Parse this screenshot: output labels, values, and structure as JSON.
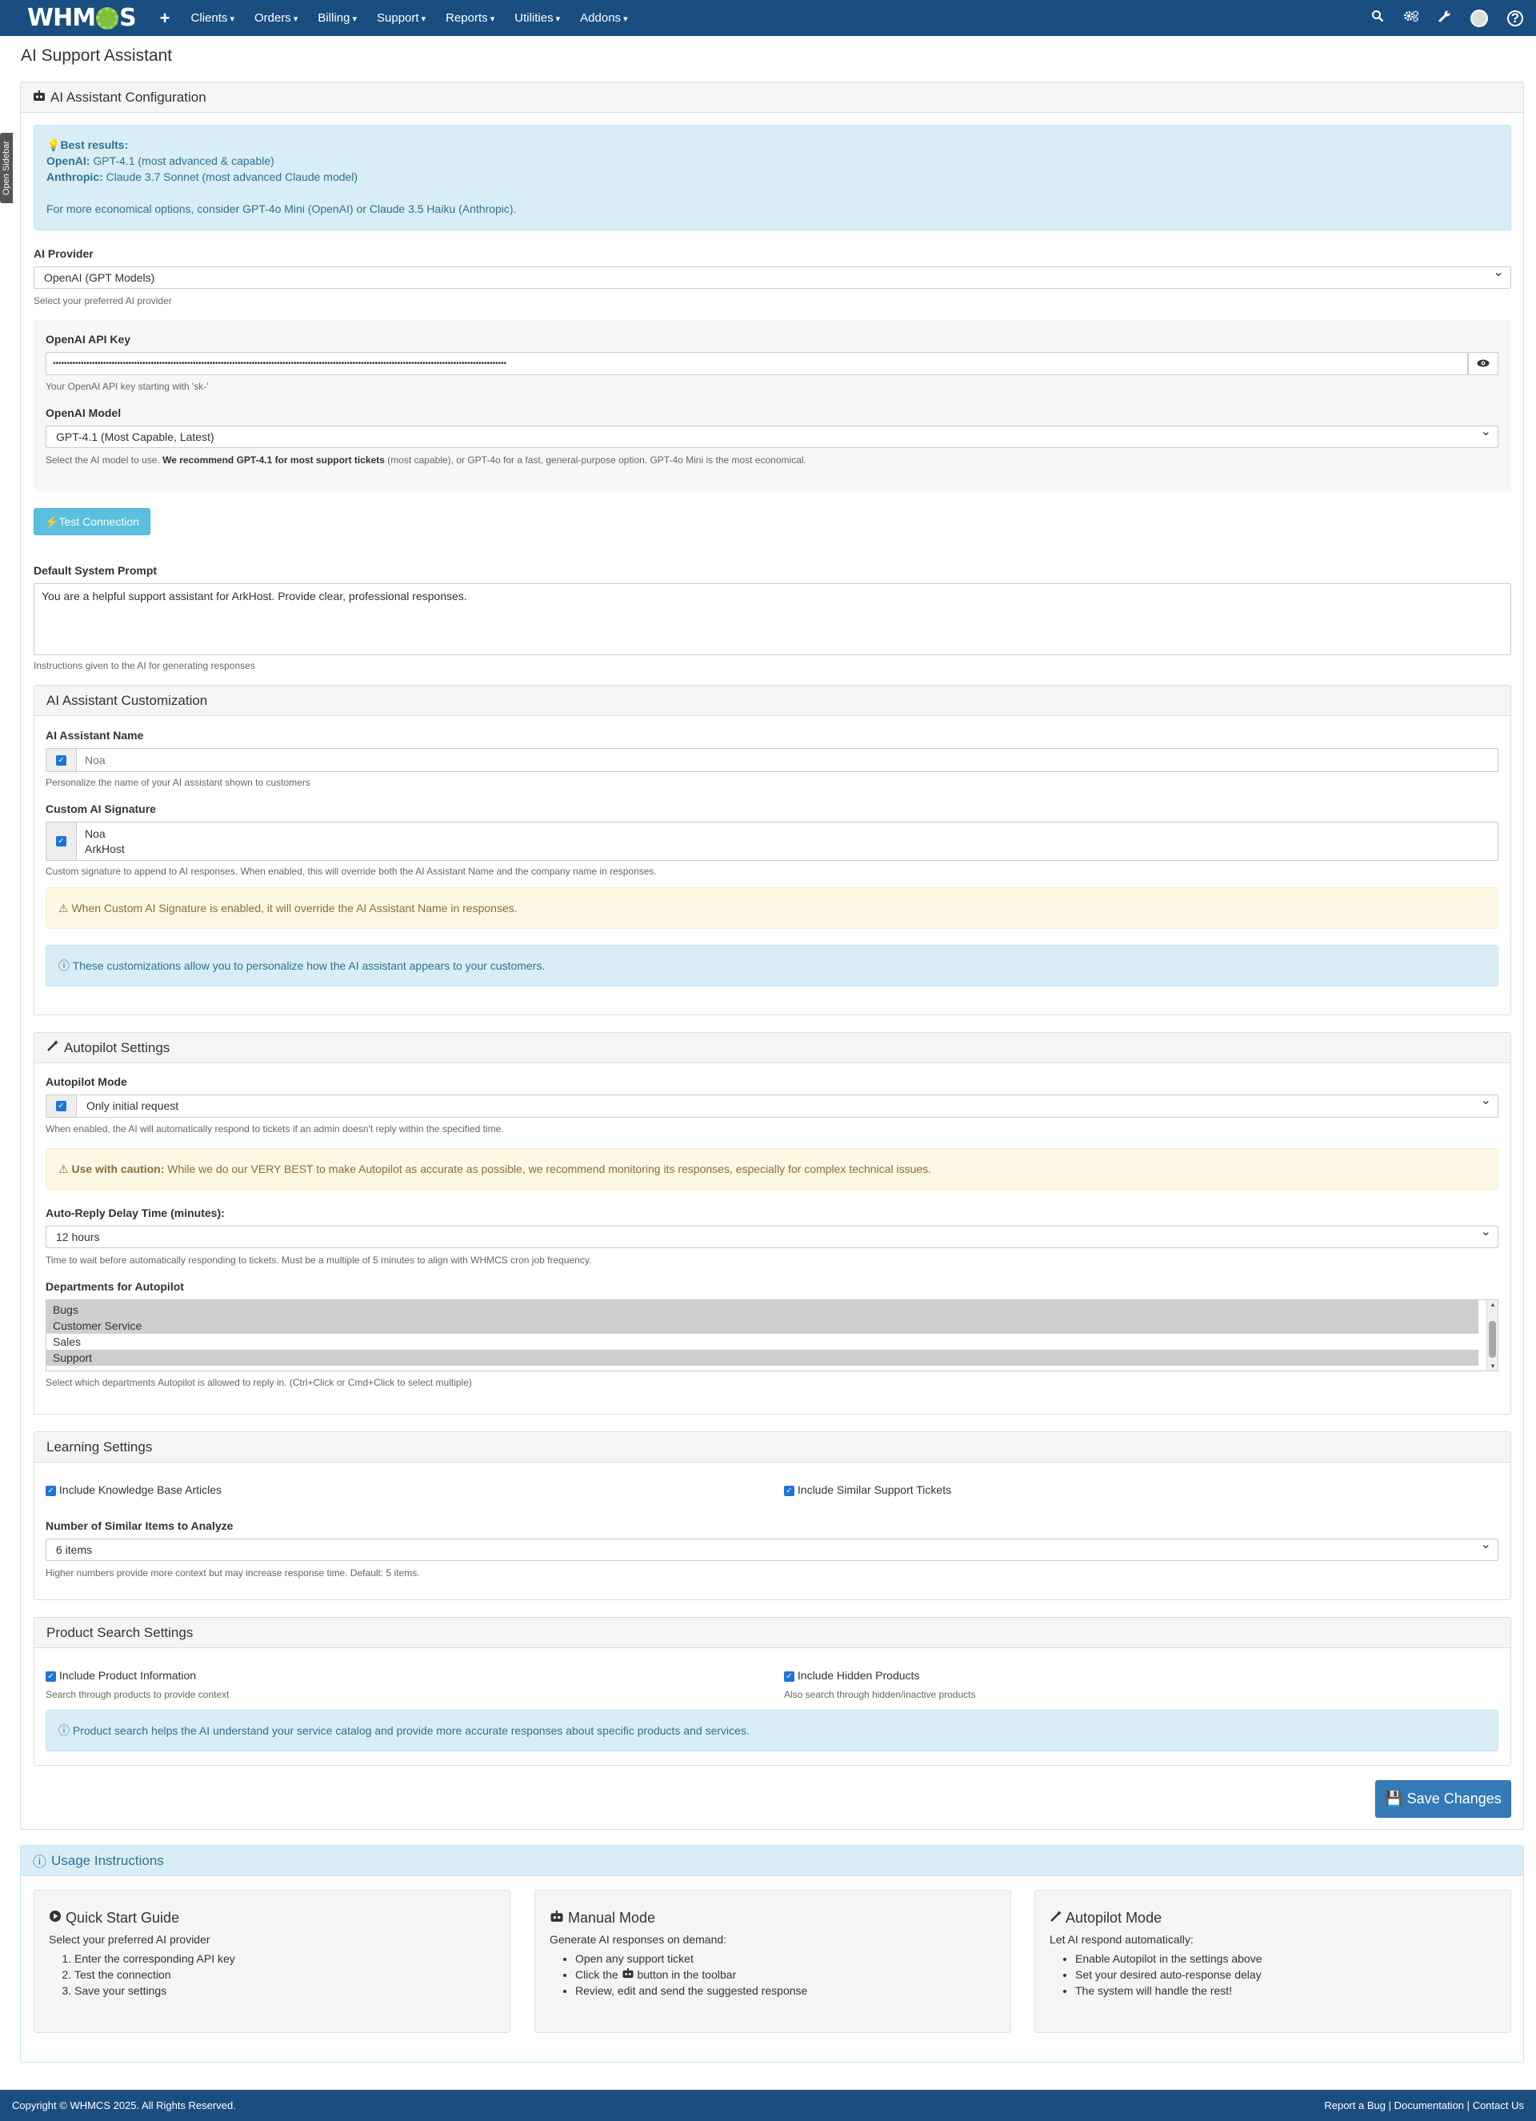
{
  "topbar": {
    "logo_text_left": "WHM",
    "logo_text_right": "S",
    "plus": "+",
    "nav": [
      "Clients",
      "Orders",
      "Billing",
      "Support",
      "Reports",
      "Utilities",
      "Addons"
    ]
  },
  "sidebar_tab": "Open Sidebar",
  "page_title": "AI Support Assistant",
  "config": {
    "heading": "AI Assistant Configuration",
    "best_results_title": "Best results:",
    "openai_label": "OpenAI:",
    "openai_rec": "GPT-4.1 (most advanced & capable)",
    "anthropic_label": "Anthropic:",
    "anthropic_rec": "Claude 3.7 Sonnet (most advanced Claude model)",
    "economical": "For more economical options, consider GPT-4o Mini (OpenAI) or Claude 3.5 Haiku (Anthropic).",
    "provider_label": "AI Provider",
    "provider_value": "OpenAI (GPT Models)",
    "provider_help": "Select your preferred AI provider",
    "api_key_label": "OpenAI API Key",
    "api_key_value": "••••••••••••••••••••••••••••••••••••••••••••••••••••••••••••••••••••••••••••••••••••••••••••••••••••••••••••••••••••••••••••••••••••••••••••••••••••••••••••••••••",
    "api_key_help": "Your OpenAI API key starting with 'sk-'",
    "model_label": "OpenAI Model",
    "model_value": "GPT-4.1 (Most Capable, Latest)",
    "model_help_1": "Select the AI model to use.",
    "model_help_bold": "We recommend GPT-4.1 for most support tickets",
    "model_help_2": "(most capable), or GPT-4o for a fast, general-purpose option. GPT-4o Mini is the most economical.",
    "test_button": "Test Connection",
    "prompt_label": "Default System Prompt",
    "prompt_value": "You are a helpful support assistant for ArkHost. Provide clear, professional responses.",
    "prompt_help": "Instructions given to the AI for generating responses"
  },
  "customization": {
    "heading": "AI Assistant Customization",
    "name_label": "AI Assistant Name",
    "name_placeholder": "Noa",
    "name_help": "Personalize the name of your AI assistant shown to customers",
    "sig_label": "Custom AI Signature",
    "sig_line1": "Noa",
    "sig_line2": "ArkHost",
    "sig_help": "Custom signature to append to AI responses. When enabled, this will override both the AI Assistant Name and the company name in responses.",
    "warn": "When Custom AI Signature is enabled, it will override the AI Assistant Name in responses.",
    "info": "These customizations allow you to personalize how the AI assistant appears to your customers."
  },
  "autopilot": {
    "heading": "Autopilot Settings",
    "mode_label": "Autopilot Mode",
    "mode_value": "Only initial request",
    "mode_help": "When enabled, the AI will automatically respond to tickets if an admin doesn't reply within the specified time.",
    "caution_bold": "Use with caution:",
    "caution_text": "While we do our VERY BEST to make Autopilot as accurate as possible, we recommend monitoring its responses, especially for complex technical issues.",
    "delay_label": "Auto-Reply Delay Time (minutes):",
    "delay_value": "12 hours",
    "delay_help": "Time to wait before automatically responding to tickets. Must be a multiple of 5 minutes to align with WHMCS cron job frequency.",
    "dept_label": "Departments for Autopilot",
    "departments": [
      {
        "name": "Bugs",
        "selected": true
      },
      {
        "name": "Customer Service",
        "selected": true
      },
      {
        "name": "Sales",
        "selected": false
      },
      {
        "name": "Support",
        "selected": true
      }
    ],
    "dept_help": "Select which departments Autopilot is allowed to reply in. (Ctrl+Click or Cmd+Click to select multiple)"
  },
  "learning": {
    "heading": "Learning Settings",
    "kb": "Include Knowledge Base Articles",
    "similar": "Include Similar Support Tickets",
    "count_label": "Number of Similar Items to Analyze",
    "count_value": "6 items",
    "count_help": "Higher numbers provide more context but may increase response time. Default: 5 items."
  },
  "product": {
    "heading": "Product Search Settings",
    "info_label": "Include Product Information",
    "info_help": "Search through products to provide context",
    "hidden_label": "Include Hidden Products",
    "hidden_help": "Also search through hidden/inactive products",
    "note": "Product search helps the AI understand your service catalog and provide more accurate responses about specific products and services."
  },
  "save_button": "Save Changes",
  "usage": {
    "heading": "Usage Instructions",
    "quick": {
      "title": "Quick Start Guide",
      "intro": "Select your preferred AI provider",
      "steps": [
        "Enter the corresponding API key",
        "Test the connection",
        "Save your settings"
      ]
    },
    "manual": {
      "title": "Manual Mode",
      "intro": "Generate AI responses on demand:",
      "item1": "Open any support ticket",
      "item2a": "Click the",
      "item2b": "button in the toolbar",
      "item3": "Review, edit and send the suggested response"
    },
    "auto": {
      "title": "Autopilot Mode",
      "intro": "Let AI respond automatically:",
      "items": [
        "Enable Autopilot in the settings above",
        "Set your desired auto-response delay",
        "The system will handle the rest!"
      ]
    }
  },
  "footer": {
    "copyright": "Copyright © WHMCS 2025. All Rights Reserved.",
    "links": [
      "Report a Bug",
      "Documentation",
      "Contact Us"
    ],
    "sep": "|"
  }
}
